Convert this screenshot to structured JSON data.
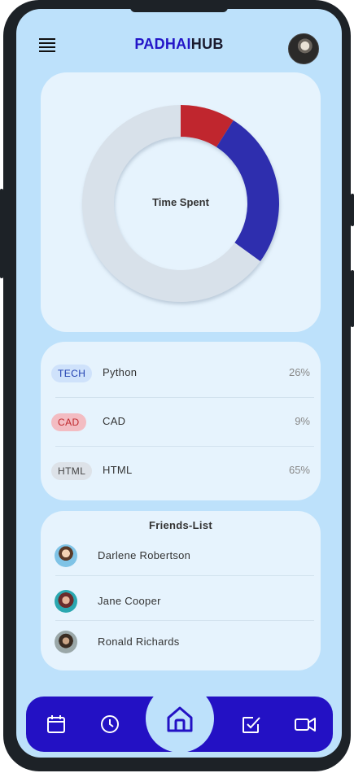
{
  "app": {
    "brand_part1": "PADHAI",
    "brand_part2": "HUB"
  },
  "chart": {
    "center_label": "Time Spent"
  },
  "chart_data": {
    "type": "pie",
    "variant": "donut",
    "title": "Time Spent",
    "slices": [
      {
        "label": "CAD",
        "value": 9,
        "color": "#c0282d"
      },
      {
        "label": "Python",
        "value": 26,
        "color": "#2e2eae"
      },
      {
        "label": "HTML",
        "value": 65,
        "color": "#d8e1ea"
      }
    ]
  },
  "stats": [
    {
      "badge": "TECH",
      "label": "Python",
      "pct": "26%",
      "badge_bg": "#cfe2fb",
      "badge_color": "#2240b0"
    },
    {
      "badge": "CAD",
      "label": "CAD",
      "pct": "9%",
      "badge_bg": "#f3bcc2",
      "badge_color": "#c0282d"
    },
    {
      "badge": "HTML",
      "label": "HTML",
      "pct": "65%",
      "badge_bg": "#dde2e8",
      "badge_color": "#444444"
    }
  ],
  "friends": {
    "title": "Friends-List",
    "items": [
      {
        "name": "Darlene Robertson"
      },
      {
        "name": "Jane Cooper"
      },
      {
        "name": "Ronald Richards"
      }
    ]
  },
  "nav": {
    "items": [
      "calendar-icon",
      "clock-icon",
      "home-icon",
      "checkbox-icon",
      "video-icon"
    ],
    "active": "home-icon",
    "bar_color": "#2311c4"
  }
}
